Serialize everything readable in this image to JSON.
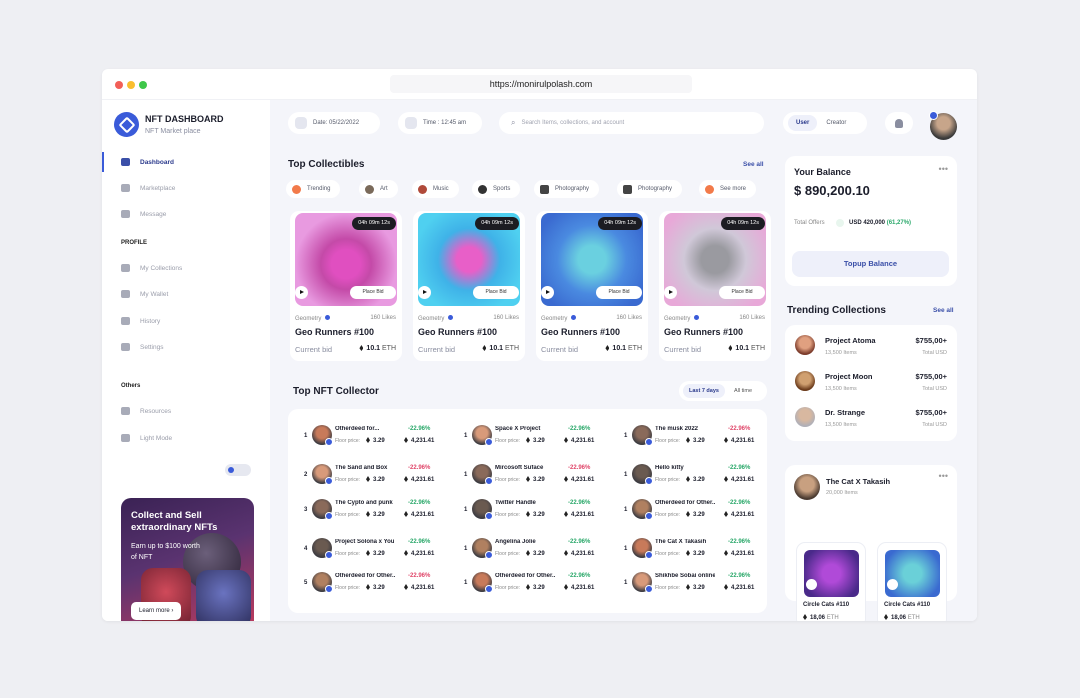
{
  "url": "https://monirulpolash.com",
  "sidebar": {
    "brand_title": "NFT DASHBOARD",
    "brand_sub": "NFT Market place",
    "nav": [
      "Dashboard",
      "Marketplace",
      "Message"
    ],
    "profile_label": "PROFILE",
    "profile_items": [
      "My Collections",
      "My Wallet",
      "History",
      "Settings"
    ],
    "others_label": "Others",
    "others_items": [
      "Resources",
      "Light Mode"
    ],
    "promo": {
      "title": "Collect and Sell extraordinary NFTs",
      "subtitle": "Earn up to $100 worth of NFT",
      "button": "Learn more"
    }
  },
  "topbar": {
    "date": "Date:  05/22/2022",
    "time": "Time :  12:45 am",
    "search_placeholder": "Search Items, collections, and account",
    "user_tab": "User",
    "creator_tab": "Creator"
  },
  "collectibles": {
    "title": "Top Collectibles",
    "see_all": "See all",
    "categories": [
      "Trending",
      "Art",
      "Music",
      "Sports",
      "Photography",
      "Photography",
      "See more"
    ],
    "cards": [
      {
        "timer": "04h 09m 12s",
        "bid_button": "Place Bid",
        "collection": "Geometry",
        "likes": "160 Likes",
        "name": "Geo Runners #100",
        "bid_label": "Current bid",
        "price": "10.1",
        "unit": "ETH"
      },
      {
        "timer": "04h 09m 12s",
        "bid_button": "Place Bid",
        "collection": "Geometry",
        "likes": "160 Likes",
        "name": "Geo Runners #100",
        "bid_label": "Current bid",
        "price": "10.1",
        "unit": "ETH"
      },
      {
        "timer": "04h 09m 12s",
        "bid_button": "Place Bid",
        "collection": "Geometry",
        "likes": "160 Likes",
        "name": "Geo Runners #100",
        "bid_label": "Current bid",
        "price": "10.1",
        "unit": "ETH"
      },
      {
        "timer": "04h 09m 12s",
        "bid_button": "Place Bid",
        "collection": "Geometry",
        "likes": "160 Likes",
        "name": "Geo Runners #100",
        "bid_label": "Current bid",
        "price": "10.1",
        "unit": "ETH"
      }
    ]
  },
  "collector": {
    "title": "Top NFT Collector",
    "tab_active": "Last 7 days",
    "tab_other": "All time",
    "floor_label": "Floor price:",
    "columns": [
      [
        {
          "rank": "1",
          "name": "Otherdeed for...",
          "floor": "3.29",
          "change": "-22.96%",
          "dir": "up",
          "total": "4,231.41"
        },
        {
          "rank": "2",
          "name": "The Sand and Box",
          "floor": "3.29",
          "change": "-22.96%",
          "dir": "down",
          "total": "4,231.61"
        },
        {
          "rank": "3",
          "name": "The Cypto and punk",
          "floor": "3.29",
          "change": "-22.96%",
          "dir": "up",
          "total": "4,231.61"
        },
        {
          "rank": "4",
          "name": "Project Solona x You",
          "floor": "3.29",
          "change": "-22.96%",
          "dir": "up",
          "total": "4,231.61"
        },
        {
          "rank": "5",
          "name": "Otherdeed for Other...",
          "floor": "3.29",
          "change": "-22.96%",
          "dir": "down",
          "total": "4,231.61"
        }
      ],
      [
        {
          "rank": "1",
          "name": "Space X Project",
          "floor": "3.29",
          "change": "-22.96%",
          "dir": "up",
          "total": "4,231.61"
        },
        {
          "rank": "1",
          "name": "Mircosoft Suface",
          "floor": "3.29",
          "change": "-22.96%",
          "dir": "down",
          "total": "4,231.61"
        },
        {
          "rank": "1",
          "name": "Twitter Handle",
          "floor": "3.29",
          "change": "-22.96%",
          "dir": "up",
          "total": "4,231.61"
        },
        {
          "rank": "1",
          "name": "Angelina Jolie",
          "floor": "3.29",
          "change": "-22.96%",
          "dir": "up",
          "total": "4,231.61"
        },
        {
          "rank": "1",
          "name": "Otherdeed for Other...",
          "floor": "3.29",
          "change": "-22.96%",
          "dir": "up",
          "total": "4,231.61"
        }
      ],
      [
        {
          "rank": "1",
          "name": "The musk 2022",
          "floor": "3.29",
          "change": "-22.96%",
          "dir": "down",
          "total": "4,231.61"
        },
        {
          "rank": "1",
          "name": "Hello kitty",
          "floor": "3.29",
          "change": "-22.96%",
          "dir": "up",
          "total": "4,231.61"
        },
        {
          "rank": "1",
          "name": "Otherdeed for Other...",
          "floor": "3.29",
          "change": "-22.96%",
          "dir": "up",
          "total": "4,231.61"
        },
        {
          "rank": "1",
          "name": "The Cat  X Takasih",
          "floor": "3.29",
          "change": "-22.96%",
          "dir": "up",
          "total": "4,231.61"
        },
        {
          "rank": "1",
          "name": "Shikhbe Sobai online",
          "floor": "3.29",
          "change": "-22.96%",
          "dir": "up",
          "total": "4,231.61"
        }
      ]
    ]
  },
  "balance": {
    "title": "Your Balance",
    "amount": "$ 890,200.10",
    "offers_label": "Total Offers",
    "offers_value": "USD 420,000",
    "offers_change": "(61,27%)",
    "topup": "Topup Balance"
  },
  "trending": {
    "title": "Trending Collections",
    "see_all": "See all",
    "items": [
      {
        "name": "Project Atoma",
        "items": "13,500 Items",
        "price": "$755,00+",
        "unit": "Total USD"
      },
      {
        "name": "Project Moon",
        "items": "13,500 Items",
        "price": "$755,00+",
        "unit": "Total USD"
      },
      {
        "name": "Dr. Strange",
        "items": "13,500 Items",
        "price": "$755,00+",
        "unit": "Total USD"
      }
    ]
  },
  "creator": {
    "name": "The Cat X Takasih",
    "items": "20,000 Items",
    "minis": [
      {
        "name": "Circle Cats #110",
        "price": "18,06",
        "unit": "ETH"
      },
      {
        "name": "Circle Cats #110",
        "price": "18,06",
        "unit": "ETH"
      }
    ]
  },
  "colors": {
    "accent": "#3a5bd9",
    "up": "#2aa86a",
    "down": "#e0476a"
  }
}
